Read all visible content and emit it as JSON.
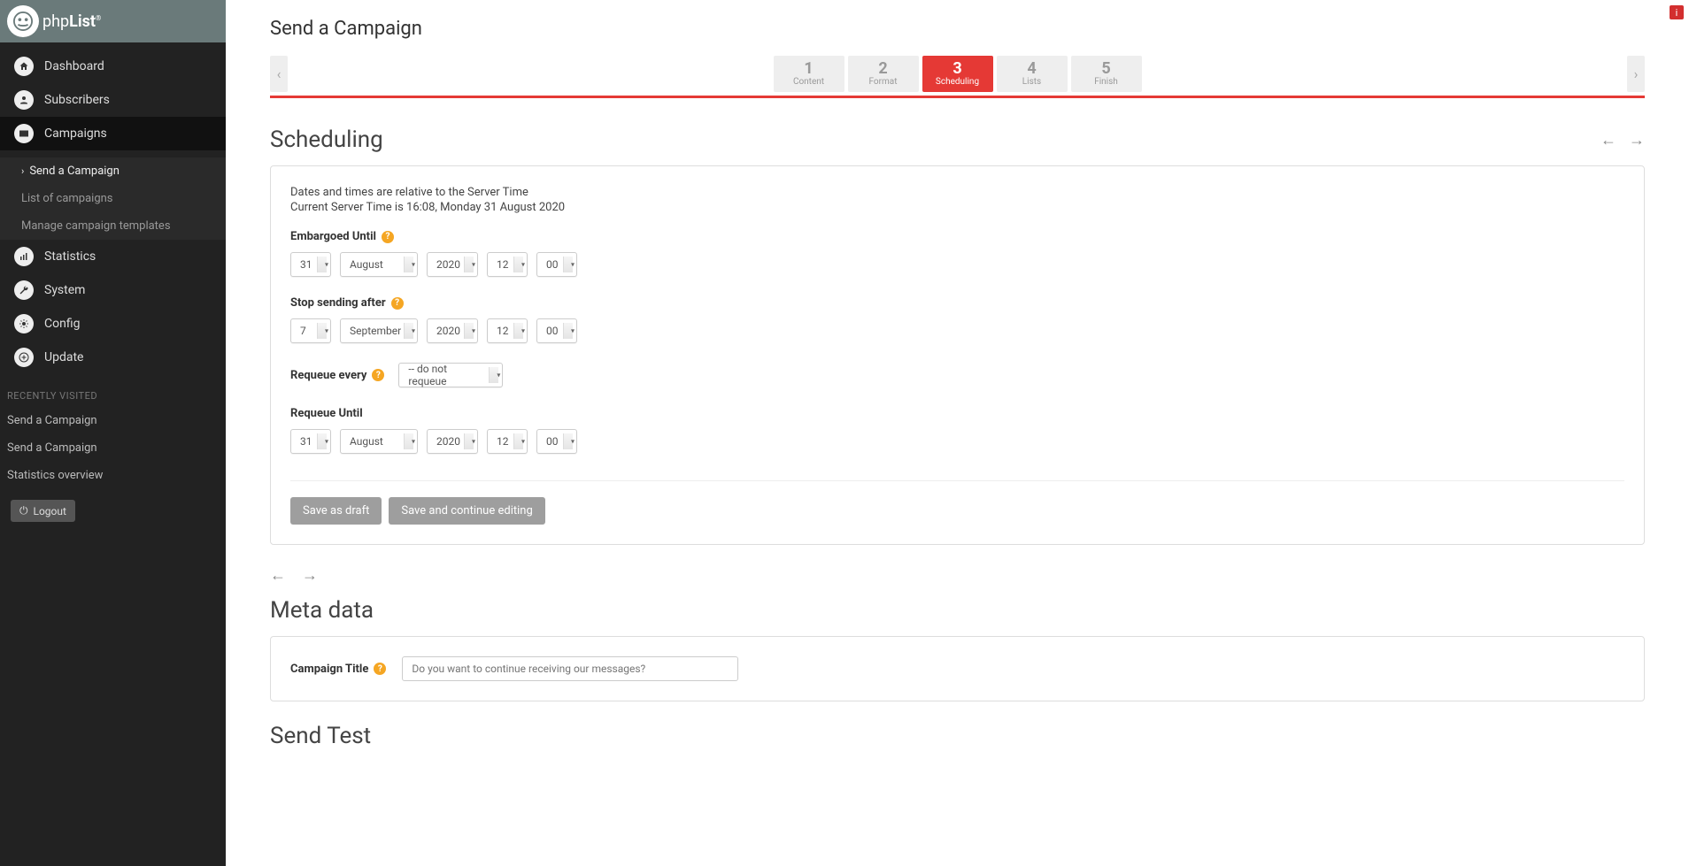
{
  "logo": {
    "brand_a": "php",
    "brand_b": "List"
  },
  "sidebar": {
    "items": [
      {
        "label": "Dashboard"
      },
      {
        "label": "Subscribers"
      },
      {
        "label": "Campaigns"
      },
      {
        "label": "Statistics"
      },
      {
        "label": "System"
      },
      {
        "label": "Config"
      },
      {
        "label": "Update"
      }
    ],
    "campaign_sub": [
      {
        "label": "Send a Campaign"
      },
      {
        "label": "List of campaigns"
      },
      {
        "label": "Manage campaign templates"
      }
    ],
    "recent_label": "RECENTLY VISITED",
    "recent": [
      {
        "label": "Send a Campaign"
      },
      {
        "label": "Send a Campaign"
      },
      {
        "label": "Statistics overview"
      }
    ],
    "logout": "Logout"
  },
  "page": {
    "title": "Send a Campaign",
    "steps": [
      {
        "num": "1",
        "label": "Content"
      },
      {
        "num": "2",
        "label": "Format"
      },
      {
        "num": "3",
        "label": "Scheduling"
      },
      {
        "num": "4",
        "label": "Lists"
      },
      {
        "num": "5",
        "label": "Finish"
      }
    ]
  },
  "scheduling": {
    "heading": "Scheduling",
    "info1": "Dates and times are relative to the Server Time",
    "info2": "Current Server Time is 16:08, Monday 31 August 2020",
    "embargo_label": "Embargoed Until",
    "embargo": {
      "day": "31",
      "month": "August",
      "year": "2020",
      "hour": "12",
      "minute": "00"
    },
    "stop_label": "Stop sending after",
    "stop": {
      "day": "7",
      "month": "September",
      "year": "2020",
      "hour": "12",
      "minute": "00"
    },
    "requeue_every_label": "Requeue every",
    "requeue_every_value": "-- do not requeue",
    "requeue_until_label": "Requeue Until",
    "requeue": {
      "day": "31",
      "month": "August",
      "year": "2020",
      "hour": "12",
      "minute": "00"
    },
    "save_draft": "Save as draft",
    "save_continue": "Save and continue editing"
  },
  "meta": {
    "heading": "Meta data",
    "title_label": "Campaign Title",
    "title_placeholder": "Do you want to continue receiving our messages?"
  },
  "test": {
    "heading": "Send Test"
  }
}
